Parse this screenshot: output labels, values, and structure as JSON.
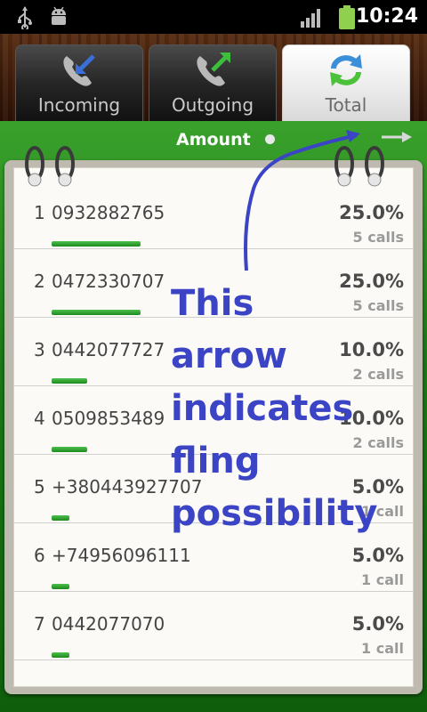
{
  "status_bar": {
    "time": "10:24",
    "icons": [
      "usb-icon",
      "android-debug-icon",
      "signal-icon",
      "battery-icon"
    ]
  },
  "tabs": [
    {
      "label": "Incoming",
      "icon": "incoming-call-icon",
      "active": false
    },
    {
      "label": "Outgoing",
      "icon": "outgoing-call-icon",
      "active": false
    },
    {
      "label": "Total",
      "icon": "refresh-arrows-icon",
      "active": true
    }
  ],
  "sort_bar": {
    "label": "Amount",
    "icons": [
      "page-indicator-dot",
      "right-arrow-icon"
    ]
  },
  "rows": [
    {
      "num": "1",
      "phone": "0932882765",
      "percent": "25.0%",
      "calls": "5 calls",
      "share": 0.25
    },
    {
      "num": "2",
      "phone": "0472330707",
      "percent": "25.0%",
      "calls": "5 calls",
      "share": 0.25
    },
    {
      "num": "3",
      "phone": "0442077727",
      "percent": "10.0%",
      "calls": "2 calls",
      "share": 0.1
    },
    {
      "num": "4",
      "phone": "0509853489",
      "percent": "10.0%",
      "calls": "2 calls",
      "share": 0.1
    },
    {
      "num": "5",
      "phone": "+380443927707",
      "percent": "5.0%",
      "calls": "1 call",
      "share": 0.05
    },
    {
      "num": "6",
      "phone": "+74956096111",
      "percent": "5.0%",
      "calls": "1 call",
      "share": 0.05
    },
    {
      "num": "7",
      "phone": "0442077070",
      "percent": "5.0%",
      "calls": "1 call",
      "share": 0.05
    }
  ],
  "annotation": {
    "lines": [
      "This arrow",
      "indicates",
      "fling",
      "possibility"
    ]
  },
  "colors": {
    "accent_green": "#1d8a1d",
    "annotation_blue": "#3a44c4"
  }
}
